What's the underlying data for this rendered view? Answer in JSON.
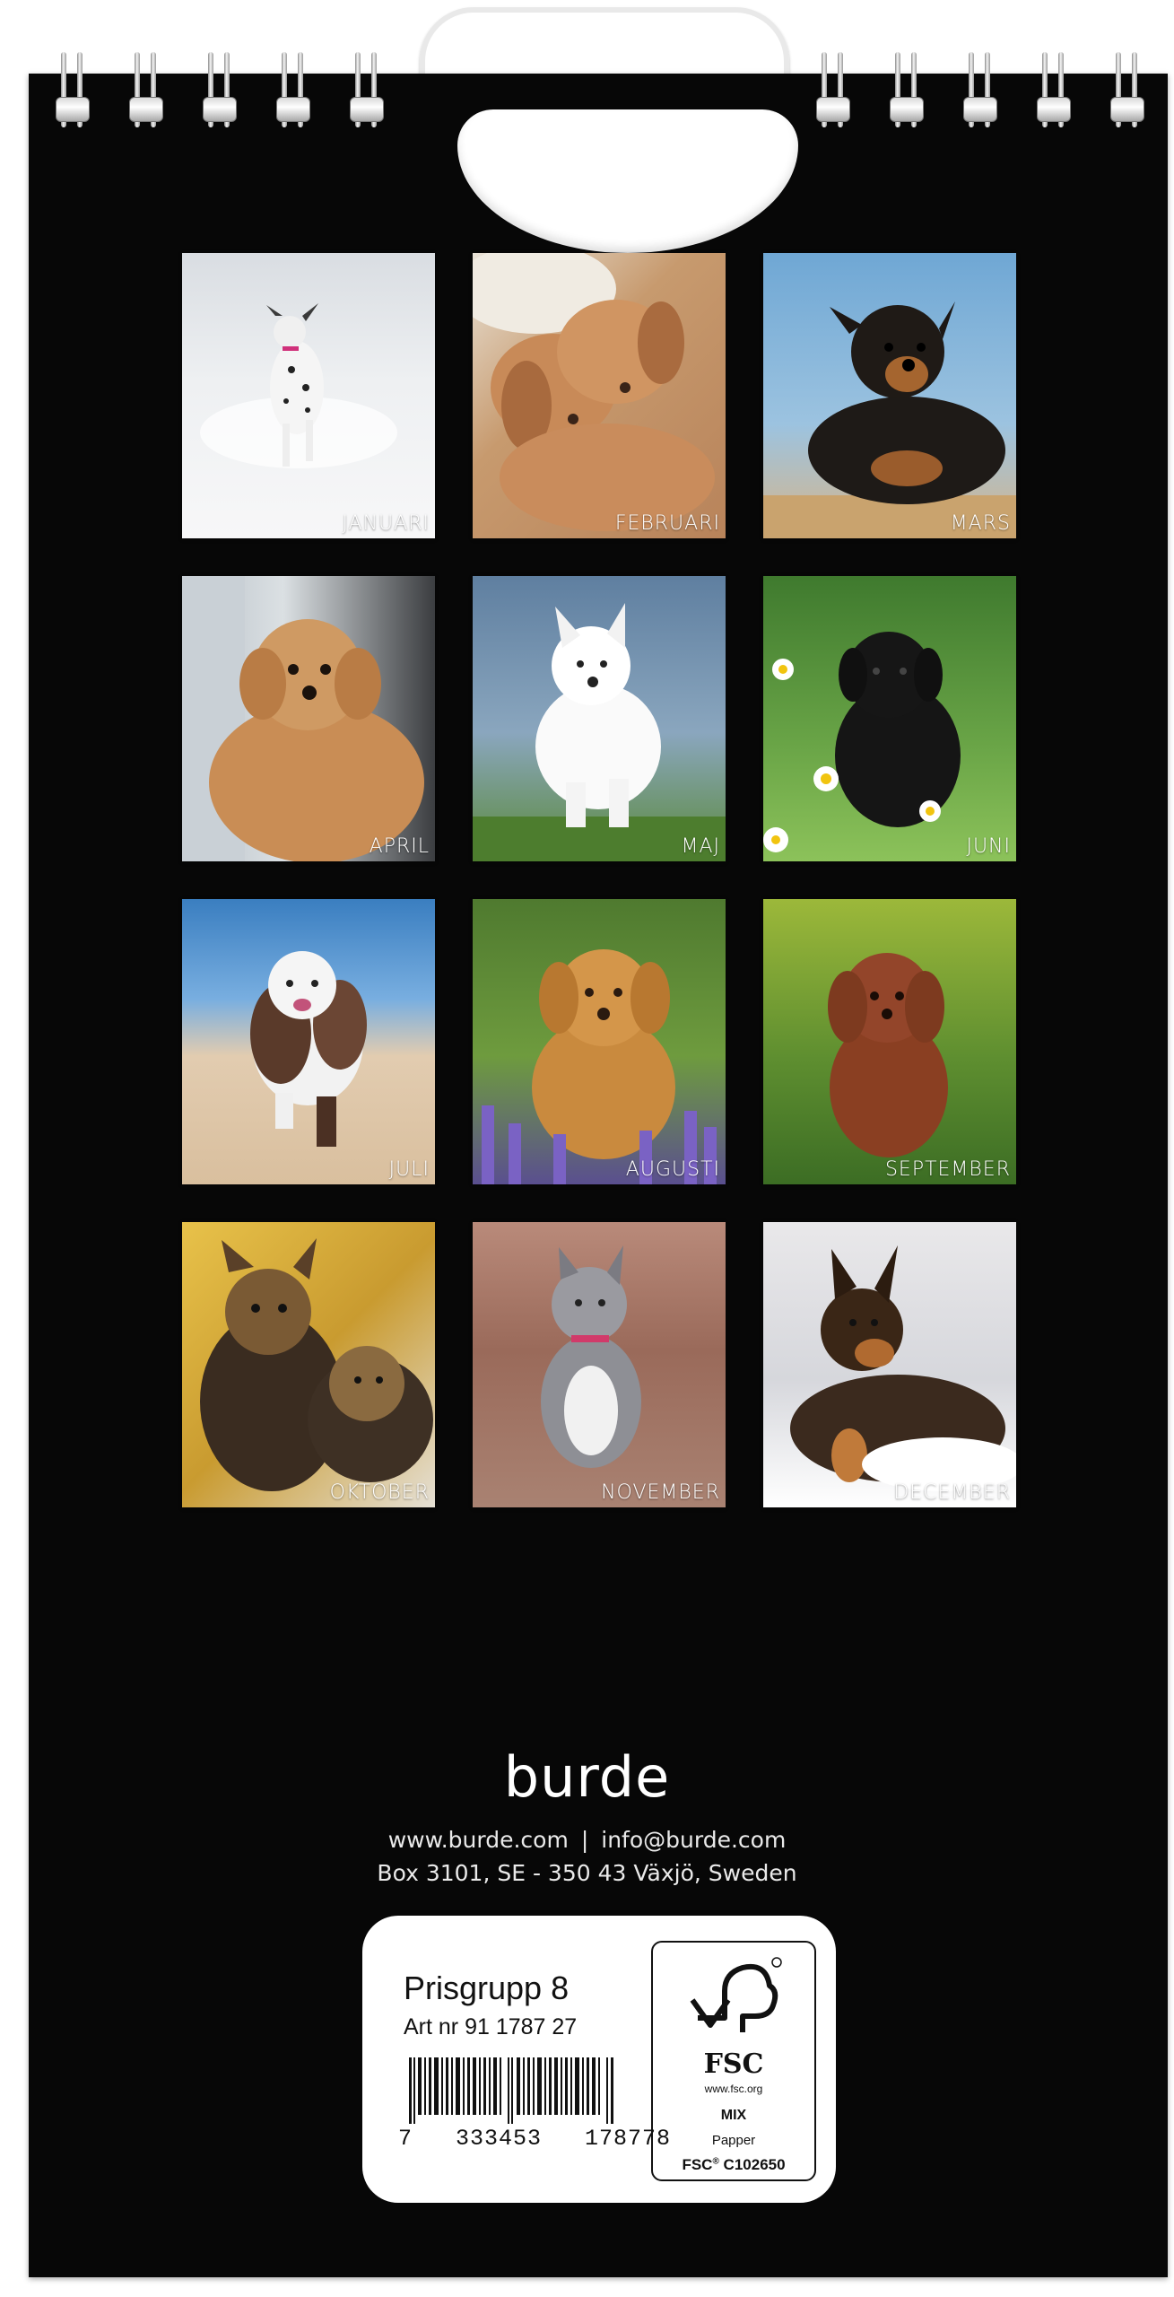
{
  "calendar": {
    "months": [
      {
        "label": "JANUARI"
      },
      {
        "label": "FEBRUARI"
      },
      {
        "label": "MARS"
      },
      {
        "label": "APRIL"
      },
      {
        "label": "MAJ"
      },
      {
        "label": "JUNI"
      },
      {
        "label": "JULI"
      },
      {
        "label": "AUGUSTI"
      },
      {
        "label": "SEPTEMBER"
      },
      {
        "label": "OKTOBER"
      },
      {
        "label": "NOVEMBER"
      },
      {
        "label": "DECEMBER"
      }
    ]
  },
  "publisher": {
    "brand": "burde",
    "website": "www.burde.com",
    "separator": "|",
    "email": "info@burde.com",
    "address": "Box 3101, SE - 350 43 Växjö, Sweden"
  },
  "label": {
    "price_group": "Prisgrupp 8",
    "article_number": "Art nr 91 1787 27",
    "barcode_digits": "7   333453   178778"
  },
  "fsc": {
    "logo_text": "FSC",
    "url": "www.fsc.org",
    "mix": "MIX",
    "papper": "Papper",
    "code_prefix": "FSC",
    "code": "C102650"
  }
}
